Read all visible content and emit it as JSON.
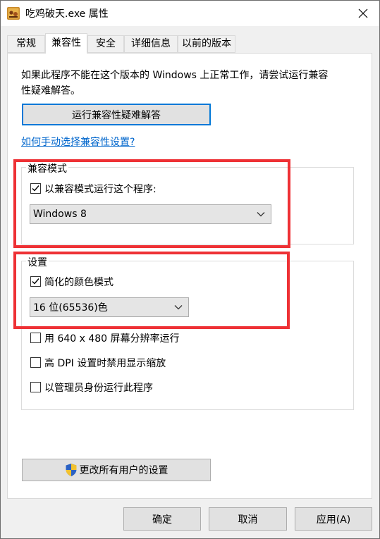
{
  "window": {
    "title": "吃鸡破天.exe 属性"
  },
  "tabs": [
    {
      "label": "常规"
    },
    {
      "label": "兼容性"
    },
    {
      "label": "安全"
    },
    {
      "label": "详细信息"
    },
    {
      "label": "以前的版本"
    }
  ],
  "compat": {
    "intro": "如果此程序不能在这个版本的 Windows 上正常工作，请尝试运行兼容性疑难解答。",
    "intro_line1": "如果此程序不能在这个版本的 Windows 上正常工作，请尝试运行兼容",
    "intro_line2": "性疑难解答。",
    "troubleshoot_button": "运行兼容性疑难解答",
    "manual_link": "如何手动选择兼容性设置?",
    "mode_group": {
      "label": "兼容模式",
      "checkbox_label": "以兼容模式运行这个程序:",
      "checked": true,
      "selected_os": "Windows 8"
    },
    "settings_group": {
      "label": "设置",
      "reduced_color": {
        "label": "简化的颜色模式",
        "checked": true
      },
      "color_depth": "16 位(65536)色",
      "res_640": {
        "label": "用 640 x 480 屏幕分辨率运行",
        "checked": false
      },
      "high_dpi": {
        "label": "高 DPI 设置时禁用显示缩放",
        "checked": false
      },
      "admin": {
        "label": "以管理员身份运行此程序",
        "checked": false
      }
    },
    "all_users_button": "更改所有用户的设置"
  },
  "footer": {
    "ok": "确定",
    "cancel": "取消",
    "apply": "应用(A)"
  },
  "colors": {
    "highlight": "#ee3135",
    "accent": "#0078d7",
    "link": "#0066cc"
  }
}
